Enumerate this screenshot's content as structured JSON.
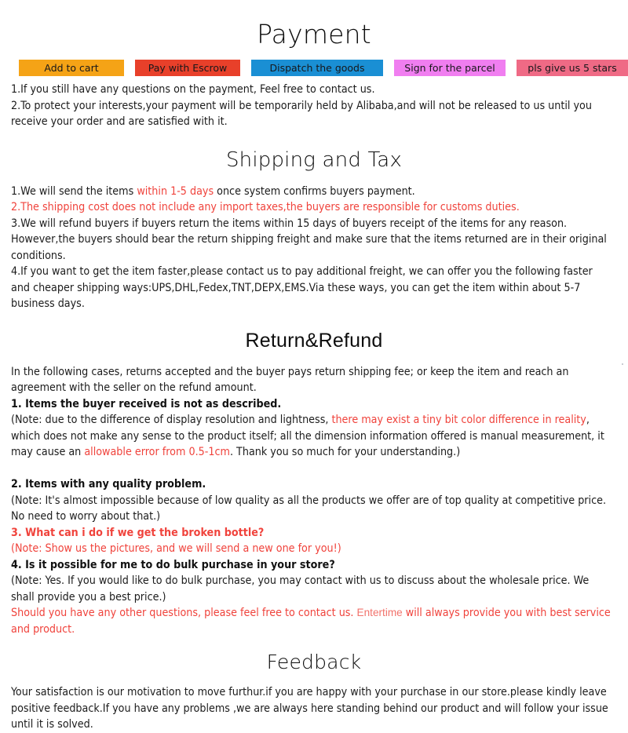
{
  "sections": {
    "payment": {
      "heading": "Payment",
      "buttons": [
        {
          "label": "Add to cart",
          "color": "#f5a316",
          "name": "add-to-cart"
        },
        {
          "label": "Pay with Escrow",
          "color": "#e8402a",
          "name": "pay-with-escrow"
        },
        {
          "label": "Dispatch the goods",
          "color": "#1a8fd4",
          "name": "dispatch-the-goods"
        },
        {
          "label": "Sign for the parcel",
          "color": "#f07ef0",
          "name": "sign-for-the-parcel"
        },
        {
          "label": "pls give us 5 stars",
          "color": "#ef6a85",
          "name": "pls-give-us-5-stars"
        }
      ],
      "line1": "1.If you still have any questions on the payment, Feel free to contact us.",
      "line2": "2.To protect your interests,your payment will be temporarily held by Alibaba,and will not be released to us until you receive your order and are satisfied with it."
    },
    "shipping": {
      "heading": "Shipping and Tax",
      "item1_pre": "1.We will send the items ",
      "item1_red": "within 1-5 days",
      "item1_post": " once system confirms buyers payment.",
      "item2_red": "2.The shipping cost does not include any import taxes,the buyers are responsible for customs duties.",
      "item3": "3.We will refund buyers if buyers return the items within 15 days of buyers receipt of the items for any reason. However,the buyers should bear the return shipping freight and make sure that the items returned are in their original conditions.",
      "item4": "4.If you want to get the item faster,please contact us to pay additional freight, we can offer you the following faster and cheaper shipping ways:UPS,DHL,Fedex,TNT,DEPX,EMS.Via these ways, you can get the item within about 5-7 business days."
    },
    "return": {
      "heading": "Return&Refund",
      "intro": "In the following cases, returns accepted and the buyer pays return shipping fee; or keep the item and reach an agreement with the seller on the refund amount.",
      "q1_bold": "1. Items the buyer received is not as described.",
      "q1_note_pre": "(Note: due to the difference of display resolution and lightness, ",
      "q1_note_red1": "there may exist a tiny bit color difference in reality",
      "q1_note_mid": ", which does not make any sense to the product itself; all the dimension information offered is manual measurement, it may cause an ",
      "q1_note_red2": "allowable error from 0.5-1cm",
      "q1_note_post": ". Thank you so much for your understanding.)",
      "q2_bold": "2. Items with any quality problem.",
      "q2_note": "(Note: It's almost impossible because of low quality as all the products we offer are of top quality at competitive price. No need to worry about that.)",
      "q3_bold_red": "3. What can i do if we get the broken bottle?",
      "q3_note_red": "(Note: Show us the pictures, and we will send a new one for you!)",
      "q4_bold": "4. Is it possible for me to do bulk purchase in your store?",
      "q4_note": "(Note: Yes. If you would like to do bulk purchase, you may contact with us to discuss about the wholesale price. We shall provide you a best price.)",
      "closing_pre": "Should you have any other questions, please feel free to contact us. ",
      "closing_brand": "Entertime",
      "closing_post": " will always provide you with best service and product."
    },
    "feedback": {
      "heading": "Feedback",
      "body": "Your satisfaction is our motivation to move furthur.if you are happy with your purchase in our store.please kindly leave positive feedback.If you have any problems ,we are always here standing behind our product and will follow your issue until it is solved."
    }
  }
}
